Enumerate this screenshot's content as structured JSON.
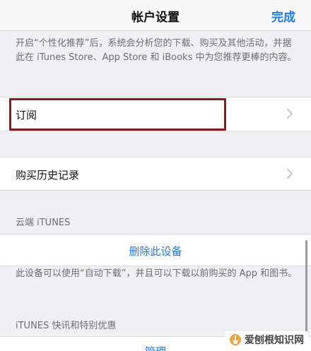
{
  "navbar": {
    "title": "帐户设置",
    "done_label": "完成"
  },
  "notes": {
    "personalization": "开启“个性化推荐”后，系统会分析您的下载、购买及其他活动，并据此在 iTunes Store、App Store 和 iBooks 中为您推荐更棒的内容。",
    "auto_download": "此设备可以使用“自动下载”，并且可以下载以前购买的 App 和图书。"
  },
  "cells": {
    "subscribe": "订阅",
    "purchase_history": "购买历史记录",
    "remove_device": "删除此设备",
    "manage": "管理"
  },
  "sections": {
    "cloud": "云端 iTUNES",
    "news": "iTUNES 快讯和特别优惠"
  },
  "watermark": {
    "text": "爱刨根知识网"
  },
  "colors": {
    "accent": "#1a7cf5",
    "highlight": "#8c1a1a",
    "background": "#efeff4"
  },
  "icons": {
    "chevron": "chevron-right-icon",
    "watermark": "shovel-logo-icon"
  }
}
